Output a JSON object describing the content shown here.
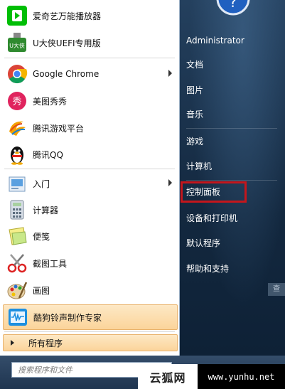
{
  "left_menu": {
    "items": [
      {
        "label": "爱奇艺万能播放器",
        "icon": "iqiyi-player-icon",
        "has_submenu": false
      },
      {
        "label": "U大侠UEFI专用版",
        "icon": "udaxia-usb-icon",
        "has_submenu": false
      },
      {
        "label": "Google Chrome",
        "icon": "chrome-icon",
        "has_submenu": true
      },
      {
        "label": "美图秀秀",
        "icon": "meitu-xiuxiu-icon",
        "has_submenu": false
      },
      {
        "label": "腾讯游戏平台",
        "icon": "tencent-game-icon",
        "has_submenu": false
      },
      {
        "label": "腾讯QQ",
        "icon": "qq-penguin-icon",
        "has_submenu": false
      },
      {
        "label": "入门",
        "icon": "getting-started-icon",
        "has_submenu": true
      },
      {
        "label": "计算器",
        "icon": "calculator-icon",
        "has_submenu": false
      },
      {
        "label": "便笺",
        "icon": "sticky-notes-icon",
        "has_submenu": false
      },
      {
        "label": "截图工具",
        "icon": "snipping-tool-icon",
        "has_submenu": false
      },
      {
        "label": "画图",
        "icon": "paint-icon",
        "has_submenu": false
      },
      {
        "label": "酷狗铃声制作专家",
        "icon": "kugou-ringtone-icon",
        "has_submenu": false
      }
    ],
    "usb_badge_text": "U大侠",
    "meitu_badge_text": "秀",
    "all_programs": "所有程序"
  },
  "search": {
    "placeholder": "搜索程序和文件"
  },
  "right_menu": {
    "user": "Administrator",
    "items": [
      "文档",
      "图片",
      "音乐",
      "游戏",
      "计算机",
      "控制面板",
      "设备和打印机",
      "默认程序",
      "帮助和支持"
    ],
    "highlighted": "控制面板"
  },
  "find_hint": "查",
  "watermark": {
    "logo_text": "云狐网",
    "url": "www.yunhu.net"
  },
  "colors": {
    "highlight_border": "#c4161c",
    "right_panel": "#13283f",
    "hover_orange": "#fbd49a"
  }
}
